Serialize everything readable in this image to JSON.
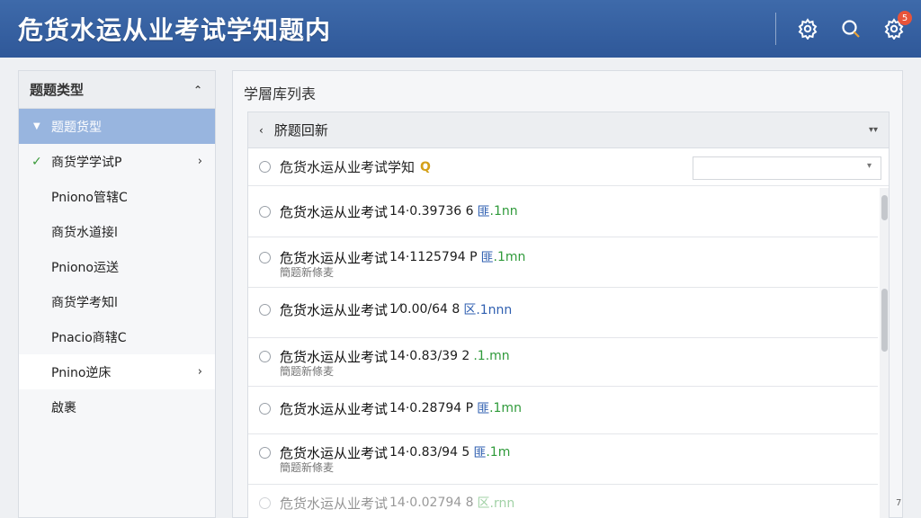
{
  "header": {
    "title": "危货水运从业考试学知题内",
    "icons": [
      "settings-gear-icon",
      "search-icon",
      "notifications-gear-icon"
    ],
    "badge_count": "5"
  },
  "sidebar": {
    "title": "题题类型",
    "items": [
      {
        "label": "题题货型",
        "state": "active"
      },
      {
        "label": "商货学学试P",
        "state": "checked",
        "has_arrow": true
      },
      {
        "label": "Pniono管辖C"
      },
      {
        "label": "商货水道接l"
      },
      {
        "label": "Pniono运送"
      },
      {
        "label": "商货学考知l"
      },
      {
        "label": "Pnacio商辖C"
      },
      {
        "label": "Pnino逆床",
        "has_arrow": true,
        "state": "hover"
      },
      {
        "label": "啟裹"
      }
    ]
  },
  "main": {
    "title": "学層库列表",
    "list_header": "脐题回新",
    "search_label": "危货水运从业考试学知",
    "search_value": "",
    "questions": [
      {
        "text": "危货水运从业考试",
        "code": "14·0.39736 6",
        "blue": "匪",
        "green": ".1nn",
        "sub": ""
      },
      {
        "text": "危货水运从业考试",
        "code": "14·1125794 P",
        "blue": "匪",
        "green": ".1mn",
        "sub": "簡题新條麦"
      },
      {
        "text": "危货水运从业考试",
        "code": "1⁄0.00/64 8",
        "blue": "区.1nnn",
        "green": "",
        "sub": ""
      },
      {
        "text": "危货水运从业考试",
        "code": "14·0.83/39 2",
        "blue": "",
        "green": ".1.mn",
        "sub": "簡题新條麦"
      },
      {
        "text": "危货水运从业考试",
        "code": "14·0.28794 P",
        "blue": "匪",
        "green": ".1mn",
        "sub": ""
      },
      {
        "text": "危货水运从业考试",
        "code": "14·0.83/94 5",
        "blue": "匪",
        "green": ".1m",
        "sub": "簡题新條麦"
      },
      {
        "text": "危货水运从业考试",
        "code": "14·0.02794 8",
        "blue": "",
        "green": "区.rnn",
        "sub": ""
      }
    ]
  },
  "footer_mark": "7"
}
